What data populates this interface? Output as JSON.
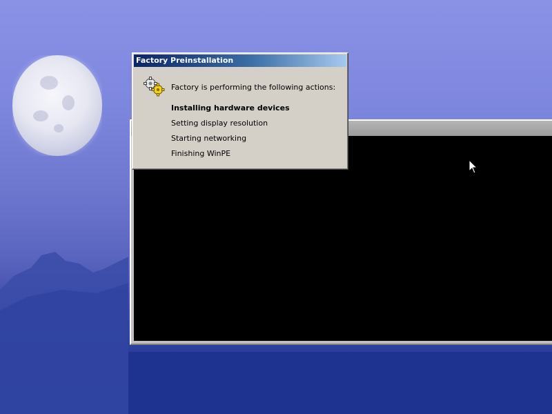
{
  "dialog": {
    "title": "Factory Preinstallation",
    "icon": "gears-icon",
    "intro": "Factory is performing the following actions:",
    "actions": [
      {
        "label": "Installing hardware devices",
        "state": "current"
      },
      {
        "label": "Setting display resolution",
        "state": "pending"
      },
      {
        "label": "Starting networking",
        "state": "pending"
      },
      {
        "label": "Finishing WinPE",
        "state": "pending"
      }
    ]
  },
  "colors": {
    "title_bar_start": "#0a246a",
    "title_bar_end": "#a6caf0",
    "dialog_face": "#d4d0c8",
    "console_background": "#000000"
  }
}
